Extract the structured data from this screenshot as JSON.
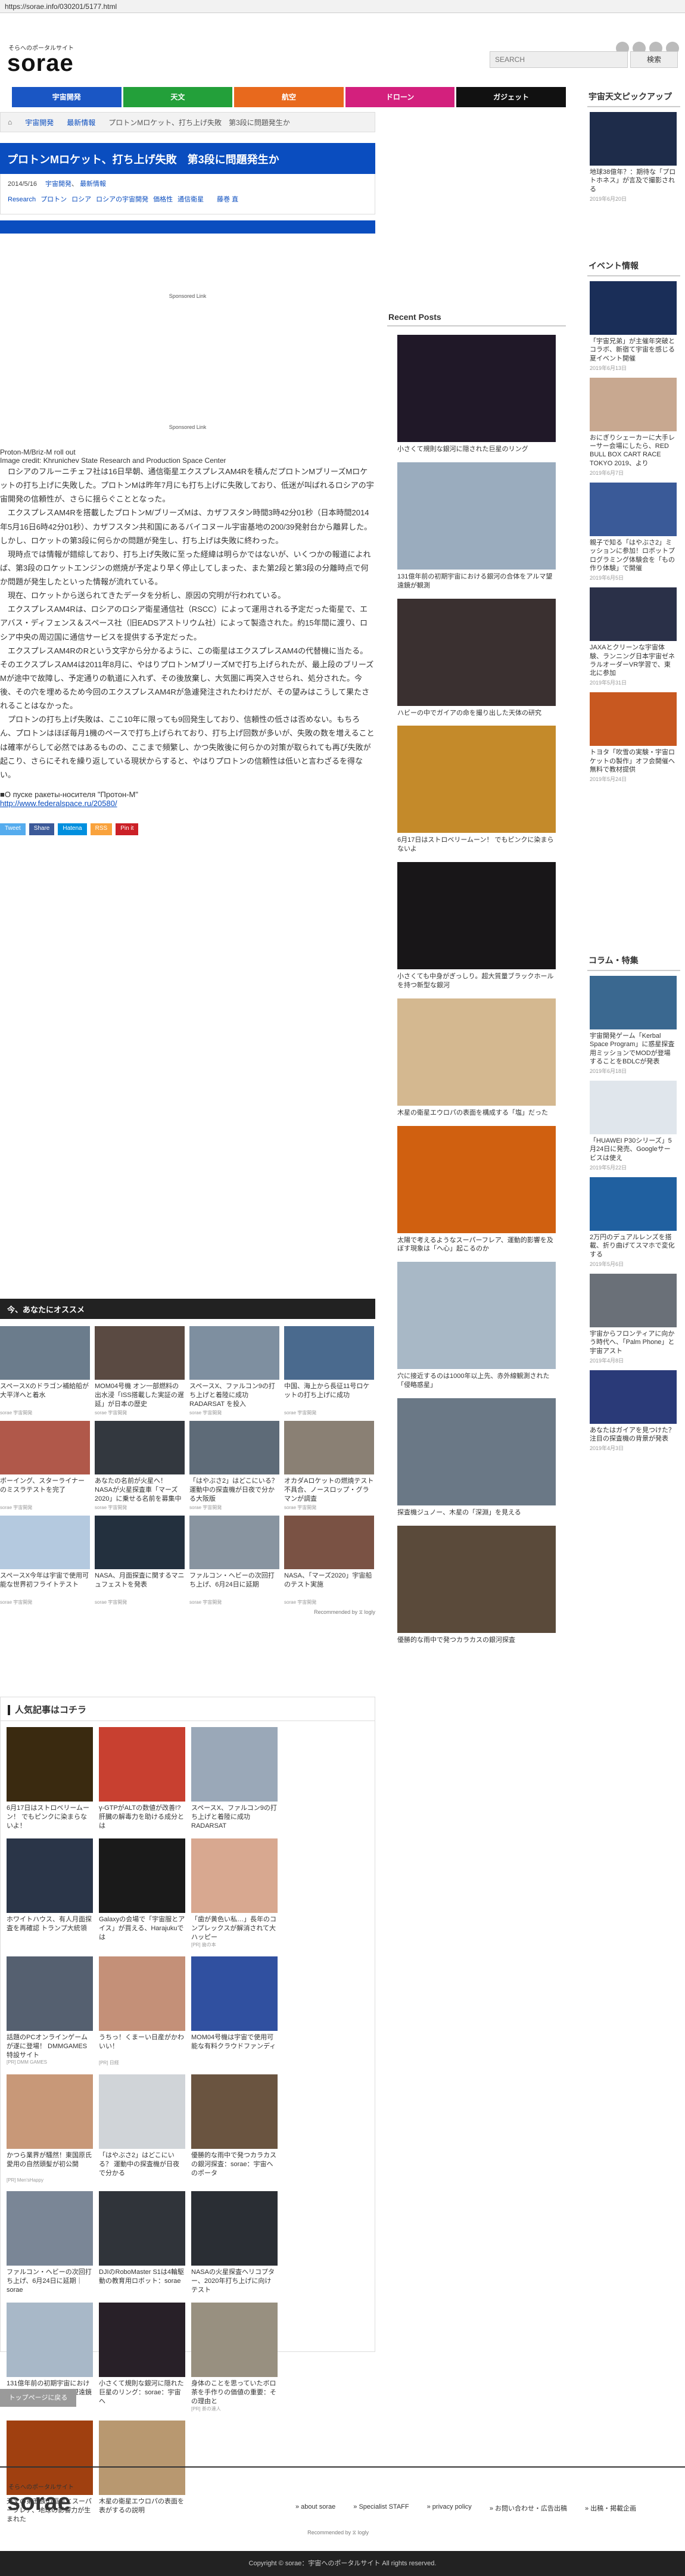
{
  "url": "https://sorae.info/030201/5177.html",
  "header": {
    "logo_sub": "そらへのポータルサイト",
    "logo": "sorae",
    "search_placeholder": "SEARCH",
    "search_button": "検索"
  },
  "nav": [
    {
      "label": "宇宙開発",
      "color": "#1a56c4"
    },
    {
      "label": "天文",
      "color": "#23a03a"
    },
    {
      "label": "航空",
      "color": "#e8691d"
    },
    {
      "label": "ドローン",
      "color": "#d3207d"
    },
    {
      "label": "ガジェット",
      "color": "#111111"
    }
  ],
  "breadcrumb": [
    "宇宙開発",
    "最新情報",
    "プロトンMロケット、打ち上げ失敗　第3段に問題発生か"
  ],
  "article": {
    "title": "プロトンMロケット、打ち上げ失敗　第3段に問題発生か",
    "date": "2014/5/16",
    "categories": [
      "宇宙開発",
      "最新情報"
    ],
    "tags": [
      "Research",
      "プロトン",
      "ロシア",
      "ロシアの宇宙開発",
      "価格性",
      "通信衛星"
    ],
    "author": "藤巻 直",
    "sponsored_label": "Sponsored Link",
    "image_alt": "Proton-M/Briz-M roll out",
    "image_credit": "Image credit: Khrunichev State Research and Production Space Center",
    "paragraphs": [
      "ロシアのフルーニチェフ社は16日早朝、通信衛星エクスプレスAM4Rを積んだプロトンMブリーズMロケットの打ち上げに失敗した。プロトンMは昨年7月にも打ち上げに失敗しており、低迷が叫ばれるロシアの宇宙開発の信頼性が、さらに揺らぐこととなった。",
      "エクスプレスAM4Rを搭載したプロトンM/ブリーズMは、カザフスタン時間3時42分01秒（日本時間2014年5月16日6時42分01秒）、カザフスタン共和国にあるバイコヌール宇宙基地の200/39発射台から離昇した。しかし、ロケットの第3段に何らかの問題が発生し、打ち上げは失敗に終わった。",
      "現時点では情報が錯綜しており、打ち上げ失敗に至った経緯は明らかではないが、いくつかの報道によれば、第3段のロケットエンジンの燃焼が予定より早く停止してしまった、また第2段と第3段の分離時点で何か問題が発生したといった情報が流れている。",
      "現在、ロケットから送られてきたデータを分析し、原因の究明が行われている。",
      "エクスプレスAM4Rは、ロシアのロシア衛星通信社（RSCC）によって運用される予定だった衛星で、エアバス・ディフェンス＆スペース社（旧EADSアストリウム社）によって製造された。約15年間に渡り、ロシア中央の周辺国に通信サービスを提供する予定だった。",
      "エクスプレスAM4RのRという文字から分かるように、この衛星はエクスプレスAM4の代替機に当たる。そのエクスプレスAM4は2011年8月に、やはりプロトンMブリーズMで打ち上げられたが、最上段のブリーズMが途中で故障し、予定通りの軌道に入れず、その後放棄し、大気圏に再突入させられ、処分された。今後、その穴を埋めるため今回のエクスプレスAM4Rが急遽発注されたわけだが、その望みはこうして果たされることはなかった。",
      "プロトンの打ち上げ失敗は、ここ10年に限っても9回発生しており、信頼性の低さは否めない。もちろん、プロトンはほぼ毎月1機のペースで打ち上げられており、打ち上げ回数が多いが、失敗の数を増えることは確率がらして必然ではあるものの、ここまで頻繁し、かつ失敗後に何らかの対策が取られても再び失敗が起こり、さらにそれを繰り返している現状からすると、やはりプロトンの信頼性は低いと言わざるを得ない。"
    ],
    "source_label": "■О пуске ракеты-носителя \"Протон-М\"",
    "source_link": "http://www.federalspace.ru/20580/",
    "share": [
      {
        "label": "Tweet",
        "color": "#55acee"
      },
      {
        "label": "Share",
        "color": "#3b5998"
      },
      {
        "label": "Hatena",
        "color": "#008fde"
      },
      {
        "label": "RSS",
        "color": "#f9a23c"
      },
      {
        "label": "Pin it",
        "color": "#cb2027"
      }
    ]
  },
  "recommend": {
    "header": "今、あなたにオススメ",
    "items": [
      {
        "text": "スペースXのドラゴン補給船が大平洋へと着水",
        "src": "sorae 宇宙開発",
        "color": "#6b7c8c"
      },
      {
        "text": "MOM04号機 オン一部燃料の出水浸「ISS搭載した実証の遅延」が日本の歴史",
        "src": "sorae 宇宙開発",
        "color": "#5a4a42"
      },
      {
        "text": "スペースX、ファルコン9の打ち上げと着陸に成功 RADARSAT を投入",
        "src": "sorae 宇宙開発",
        "color": "#7e8fa0"
      },
      {
        "text": "中国、海上から長征11号ロケットの打ち上げに成功",
        "src": "sorae 宇宙開発",
        "color": "#4a6a8e"
      },
      {
        "text": "ボーイング、スターライナーのミスラテストを完了",
        "src": "sorae 宇宙開発",
        "color": "#b0584a"
      },
      {
        "text": "あなたの名前が火星へ！ NASAが火星探査車「マーズ2020」に乗せる名前を募集中",
        "src": "sorae 宇宙開発",
        "color": "#33383f"
      },
      {
        "text": "「はやぶさ2」はどこにいる？ 運動中の探査機が日夜で分かる大阪版",
        "src": "sorae 宇宙開発",
        "color": "#5e6b78"
      },
      {
        "text": "オカダAロケットの燃焼テスト不具合、ノースロップ・グラマンが調査",
        "src": "sorae 宇宙開発",
        "color": "#8a8074"
      },
      {
        "text": "スペースX今年は宇宙で使用可能な世界初フライトテスト",
        "src": "sorae 宇宙開発",
        "color": "#b4c9df"
      },
      {
        "text": "NASA、月面探査に関するマニュフェストを発表",
        "src": "sorae 宇宙開発",
        "color": "#23303e"
      },
      {
        "text": "ファルコン・ヘビーの次回打ち上げ、6月24日に延期",
        "src": "sorae 宇宙開発",
        "color": "#8894a0"
      },
      {
        "text": "NASA、「マーズ2020」宇宙船のテスト実施",
        "src": "sorae 宇宙開発",
        "color": "#7a5244"
      }
    ],
    "footer": "Recommended by ⧖ logly"
  },
  "popular": {
    "header": "人気記事はコチラ",
    "items": [
      {
        "text": "6月17日はストロベリームーン！ でもピンクに染まらないよ！",
        "src": "",
        "color": "#3a2a10"
      },
      {
        "text": "γ-GTPがALTの数値が改善!?肝臓の解毒力を助ける成分とは",
        "src": "",
        "color": "#c84030"
      },
      {
        "text": "スペースX、ファルコン9の打ち上げと着陸に成功 RADARSAT",
        "src": "",
        "color": "#9aa8b8"
      },
      {
        "text": "ホワイトハウス、有人月面探査を再確認 トランプ大統領",
        "src": "",
        "color": "#2a3548"
      },
      {
        "text": "Galaxyの会場で「宇宙服とアイス」が買える、Harajukuでは",
        "src": "",
        "color": "#1a1a1a"
      },
      {
        "text": "「歯が黄色い私…」長年のコンプレックスが解消されて大ハッピー",
        "src": "[PR] 歯の本",
        "color": "#d8a890"
      },
      {
        "text": "話題のPCオンラインゲームが遂に登場！ DMMGAMES特設サイト",
        "src": "[PR] DMM GAMES",
        "color": "#556070"
      },
      {
        "text": "うちっ！くまーい日産がかわいい！",
        "src": "[PR] 日経",
        "color": "#c49078"
      },
      {
        "text": "MOM04号機は宇宙で使用可能な有料クラウドファンディ",
        "src": "",
        "color": "#3050a0"
      },
      {
        "text": "かつら業界が騒然！東国原氏愛用の自然頭髪が初公開",
        "src": "[PR] Men'sHappy",
        "color": "#c89878"
      },
      {
        "text": "「はやぶさ2」はどこにいる？ 運動中の探査機が日夜で分かる",
        "src": "",
        "color": "#d0d4d8"
      },
      {
        "text": "優勝的な雨中で発つカラカスの銀河探査：sorae：宇宙へのポータ",
        "src": "",
        "color": "#6a5440"
      },
      {
        "text": "ファルコン・ヘビーの次回打ち上げ、6月24日に延期｜sorae",
        "src": "",
        "color": "#7a8696"
      },
      {
        "text": "DJIのRoboMaster S1は4輪駆動の教育用ロボット：sorae",
        "src": "",
        "color": "#30343a"
      },
      {
        "text": "NASAの火星探査ヘリコプター、2020年打ち上げに向けテスト",
        "src": "",
        "color": "#2a2e34"
      },
      {
        "text": "131億年前の初期宇宙における銀河の合体をアルマ望遠鏡が観測",
        "src": "",
        "color": "#a8b8c8"
      },
      {
        "text": "小さくて規則な銀河に隠れた巨星のリング：sorae：宇宙へ",
        "src": "",
        "color": "#282028"
      },
      {
        "text": "身体のことを思っていたボロ茶を手作りの価値の重要：その理由と",
        "src": "[PR] 茶の達人",
        "color": "#989080"
      },
      {
        "text": "天文の第五族の恒星とスーパーフレア、地球の影響力が生まれた",
        "src": "",
        "color": "#a04010"
      },
      {
        "text": "木星の衛星エウロパの表面を表がするの説明",
        "src": "",
        "color": "#b89870"
      }
    ],
    "footer": "Recommended by ⧖ logly"
  },
  "sidebar": {
    "pickup_title": "宇宙天文ピックアップ",
    "pickup": [
      {
        "text": "地球38億年？：期待な「プロトホネス」が言及で撮影される",
        "date": "2019年6月20日",
        "color": "#1e2c4a"
      }
    ],
    "events_title": "イベント情報",
    "events": [
      {
        "text": "「宇宙兄弟」が主催年突破とコラボ、新宿て宇宙を感じる夏イベント開催",
        "date": "2019年6月13日",
        "color": "#1a2e58"
      },
      {
        "text": "おにぎりシェーカーに大手レーサー会場にしたら、RED BULL BOX CART RACE TOKYO 2019、より",
        "date": "2019年6月7日",
        "color": "#c8a890"
      },
      {
        "text": "親子で知る「はやぶさ2」ミッションに参加！ロボットプログラミング体験会を「もの作り体験」で開催",
        "date": "2019年6月5日",
        "color": "#3a5a98"
      },
      {
        "text": "JAXAとクリーンな宇宙体験、ランニング日本宇宙ゼネラルオーダーVR学習で、東北に参加",
        "date": "2019年5月31日",
        "color": "#2a3048"
      },
      {
        "text": "トヨタ「吹雪の実験・宇宙ロケットの製作」オフ会開催へ 無料で教材提供",
        "date": "2019年5月24日",
        "color": "#c85820"
      }
    ],
    "column_title": "コラム・特集",
    "column": [
      {
        "text": "宇宙開発ゲーム「Kerbal Space Program」に惑星探査用ミッションでMODが登場することをBDLCが発表",
        "date": "2019年6月18日",
        "color": "#3a6890"
      },
      {
        "text": "「HUAWEI P30シリーズ」5月24日に発売、Googleサービスは使え",
        "date": "2019年5月22日",
        "color": "#e0e6ec"
      },
      {
        "text": "2万円のデュアルレンズを搭載、折り曲げてスマホで変化する",
        "date": "2019年5月6日",
        "color": "#2060a0"
      },
      {
        "text": "宇宙からフロンティアに向かう時代へ、「Palm Phone」と宇宙アスト",
        "date": "2019年4月8日",
        "color": "#6a7078"
      },
      {
        "text": "あなたはガイアを見つけた？ 注目の探査機の背景が発表",
        "date": "2019年4月3日",
        "color": "#2a3a78"
      }
    ]
  },
  "recent": {
    "title": "Recent Posts",
    "items": [
      {
        "text": "小さくて規則な銀河に隠された巨星のリング",
        "color": "#201828"
      },
      {
        "text": "131億年前の初期宇宙における銀河の合体をアルマ望遠鏡が観測",
        "color": "#9aacbe"
      },
      {
        "text": "ハビーの中でガイアの命を撮り出した天体の研究",
        "color": "#3a3030"
      },
      {
        "text": "6月17日はストロベリームーン！ でもピンクに染まらないよ",
        "color": "#c48a2a"
      },
      {
        "text": "小さくても中身がぎっしり。超大質量ブラックホールを持つ新型な銀河",
        "color": "#181618"
      },
      {
        "text": "木星の衛星エウロパの表面を構成する「塩」だった",
        "color": "#d4b890"
      },
      {
        "text": "太陽で考えるようなスーパーフレア、運動的影響を及ぼす現象は「ヘ心」起こるのか",
        "color": "#d06010"
      },
      {
        "text": "穴に接近するのは1000年以上先、赤外線観測された「侵略惑星」",
        "color": "#a8b8c6"
      },
      {
        "text": "探査機ジュノー、木星の「深淵」を見える",
        "color": "#6a7886"
      },
      {
        "text": "優勝的な雨中で発つカラカスの銀河探査",
        "color": "#5a4a3a"
      }
    ]
  },
  "back_to_top": "トップページに戻る",
  "footer": {
    "logo_sub": "そらへのポータルサイト",
    "logo": "sorae",
    "links": [
      "about sorae",
      "Specialist STAFF",
      "privacy policy",
      "お問い合わせ・広告出稿",
      "出稿・掲載企画"
    ],
    "copyright": "Copyright © sorae：宇宙へのポータルサイト All rights reserved."
  }
}
